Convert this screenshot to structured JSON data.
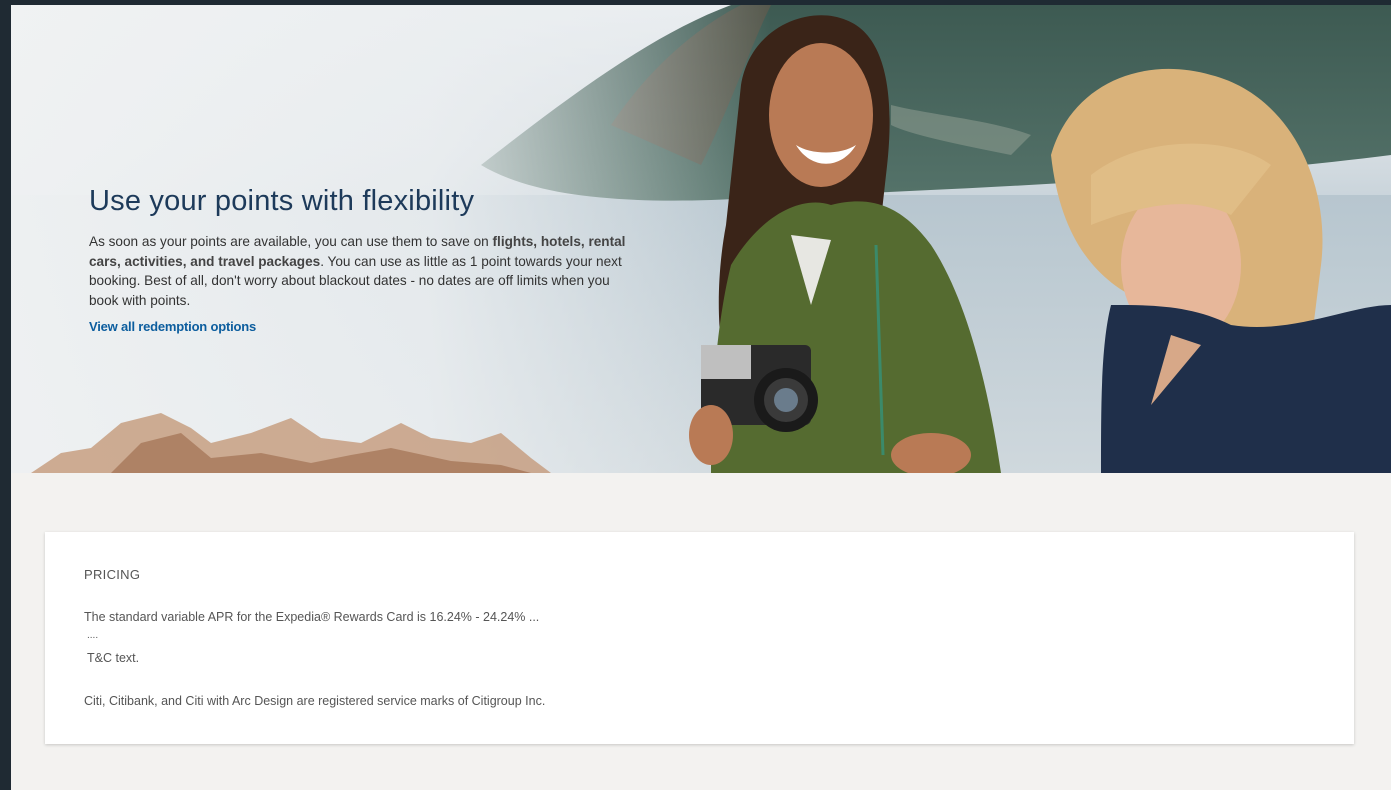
{
  "hero": {
    "title": "Use your points with flexibility",
    "body_parts": [
      "As soon as your points are available, you can use them to save on ",
      "flights, hotels, rental cars, activities, and travel packages",
      ". You can use as little as 1 point towards your next booking. Best of all, don't worry about blackout dates - no dates are off limits when you book with points."
    ],
    "link_label": "View all redemption options"
  },
  "pricing": {
    "heading": "PRICING",
    "apr_text": "The standard variable APR for the Expedia® Rewards Card is 16.24% - 24.24% ...",
    "ellipsis": "....",
    "tc_text": "T&C text.",
    "trademark_text": "Citi, Citibank, and Citi with Arc Design are registered service marks of Citigroup Inc."
  },
  "colors": {
    "title": "#1d3a5a",
    "link": "#0c5d9e",
    "page_bg": "#f3f2f0",
    "outer_bg": "#1f2a33"
  }
}
